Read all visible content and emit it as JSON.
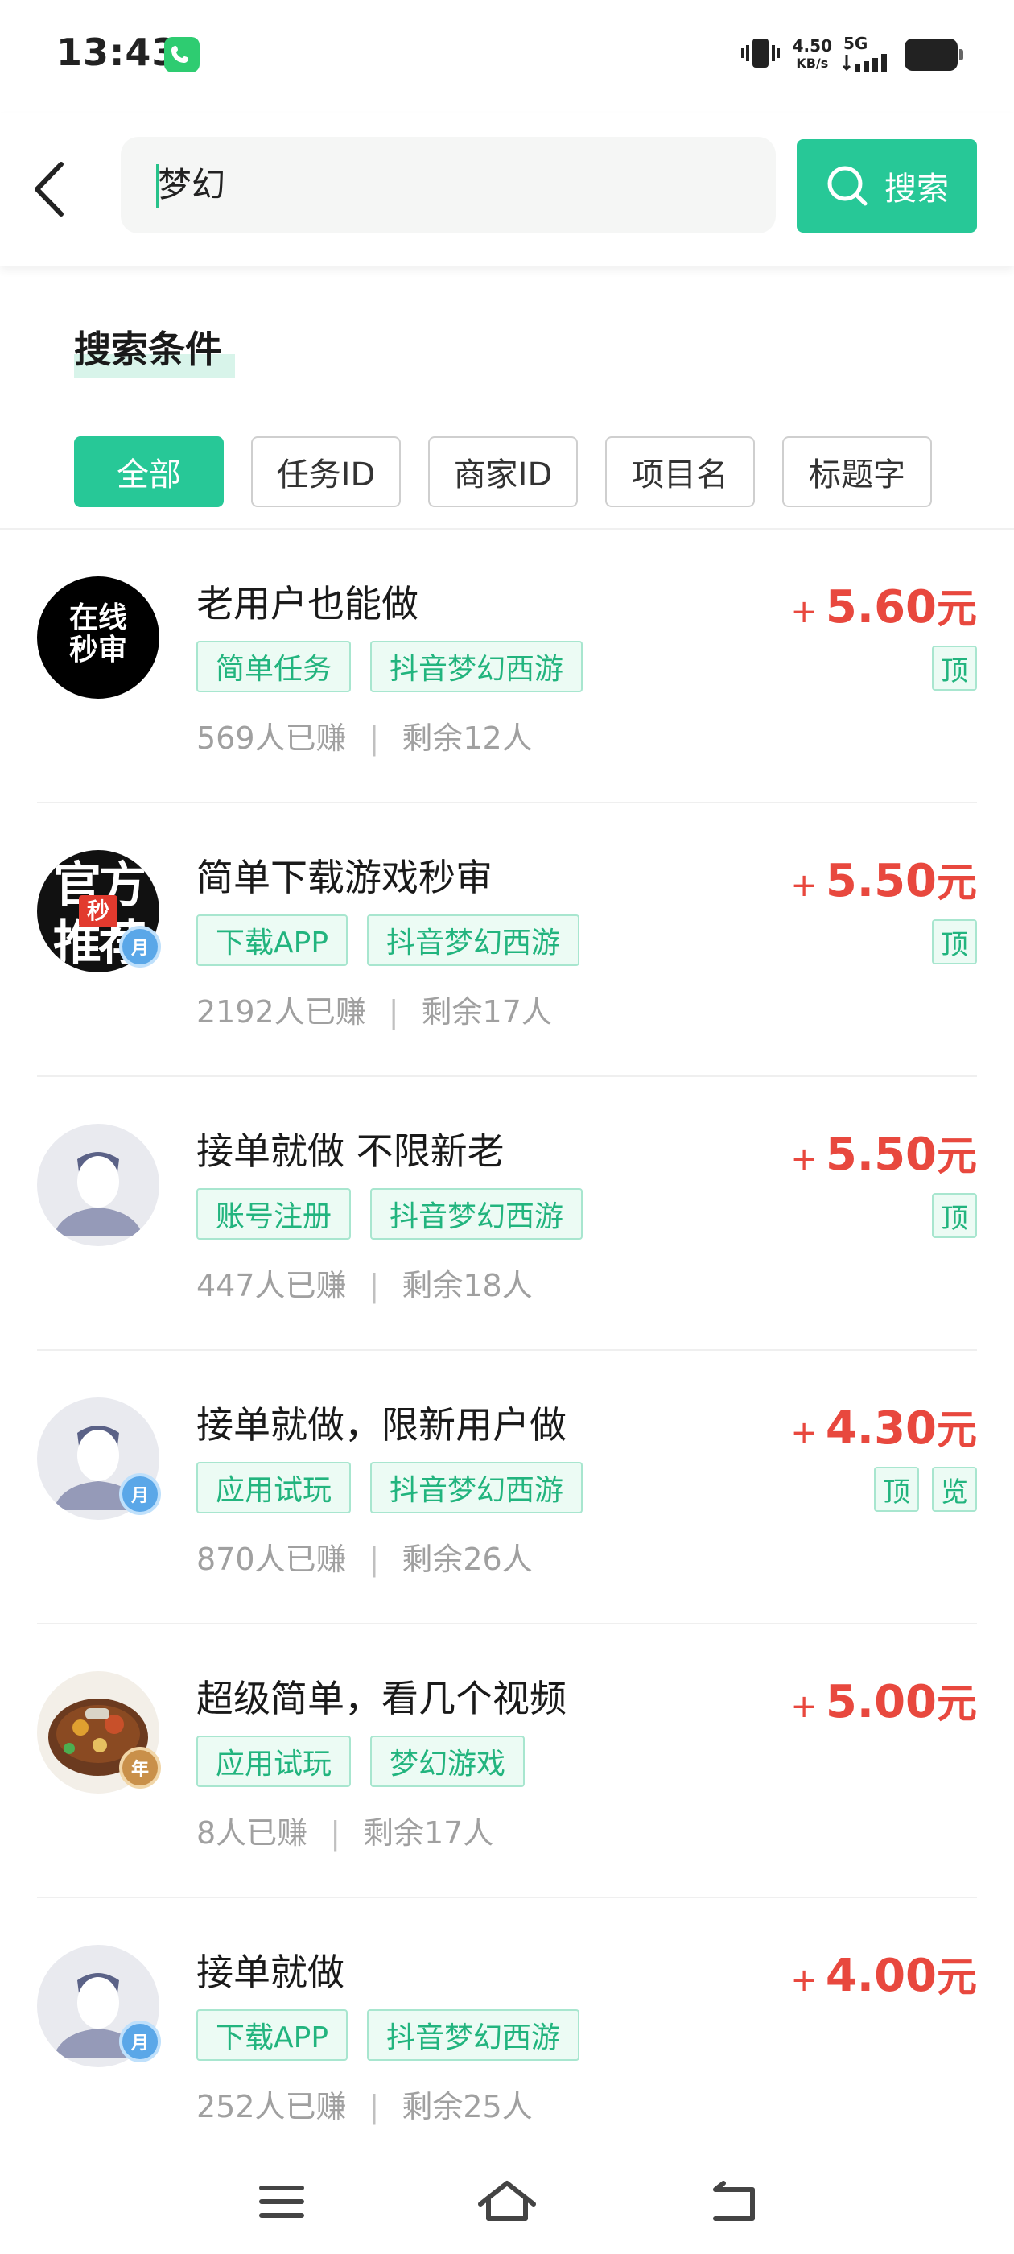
{
  "status_bar": {
    "time": "13:43",
    "speed_value": "4.50",
    "speed_unit": "KB/s",
    "network": "5G"
  },
  "search": {
    "query": "梦幻",
    "button_label": "搜索"
  },
  "conditions": {
    "title": "搜索条件",
    "filters": [
      "全部",
      "任务ID",
      "商家ID",
      "项目名",
      "标题字"
    ],
    "active_filter": "全部"
  },
  "tasks": [
    {
      "title": "老用户也能做",
      "tags": [
        "简单任务",
        "抖音梦幻西游"
      ],
      "earned": "569人已赚",
      "remaining": "剩余12人",
      "price": "5.60",
      "unit": "元",
      "marks": [
        "顶"
      ],
      "avatar": {
        "type": "text",
        "line1": "在线",
        "line2": "秒审"
      },
      "badge": ""
    },
    {
      "title": "简单下载游戏秒审",
      "tags": [
        "下载APP",
        "抖音梦幻西游"
      ],
      "earned": "2192人已赚",
      "remaining": "剩余17人",
      "price": "5.50",
      "unit": "元",
      "marks": [
        "顶"
      ],
      "avatar": {
        "type": "official",
        "line1": "官方",
        "line2": "推荐",
        "stamp": "秒"
      },
      "badge": "月"
    },
    {
      "title": "接单就做 不限新老",
      "tags": [
        "账号注册",
        "抖音梦幻西游"
      ],
      "earned": "447人已赚",
      "remaining": "剩余18人",
      "price": "5.50",
      "unit": "元",
      "marks": [
        "顶"
      ],
      "avatar": {
        "type": "default"
      },
      "badge": ""
    },
    {
      "title": "接单就做，限新用户做",
      "tags": [
        "应用试玩",
        "抖音梦幻西游"
      ],
      "earned": "870人已赚",
      "remaining": "剩余26人",
      "price": "4.30",
      "unit": "元",
      "marks": [
        "顶",
        "览"
      ],
      "avatar": {
        "type": "default"
      },
      "badge": "月"
    },
    {
      "title": "超级简单，看几个视频",
      "tags": [
        "应用试玩",
        "梦幻游戏"
      ],
      "earned": "8人已赚",
      "remaining": "剩余17人",
      "price": "5.00",
      "unit": "元",
      "marks": [],
      "avatar": {
        "type": "food"
      },
      "badge": "年"
    },
    {
      "title": "接单就做",
      "tags": [
        "下载APP",
        "抖音梦幻西游"
      ],
      "earned": "252人已赚",
      "remaining": "剩余25人",
      "price": "4.00",
      "unit": "元",
      "marks": [],
      "avatar": {
        "type": "default"
      },
      "badge": "月"
    }
  ],
  "colors": {
    "accent": "#27c897",
    "price": "#e8483e",
    "tag_text": "#22b47e"
  }
}
